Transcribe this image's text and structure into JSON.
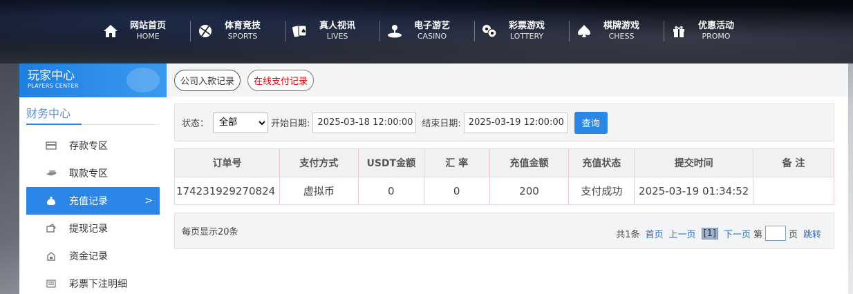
{
  "nav": [
    {
      "cn": "网站首页",
      "en": "HOME",
      "icon": "home-icon"
    },
    {
      "cn": "体育竞技",
      "en": "SPORTS",
      "icon": "ball-icon"
    },
    {
      "cn": "真人视讯",
      "en": "LIVES",
      "icon": "cards-icon"
    },
    {
      "cn": "电子游艺",
      "en": "CASINO",
      "icon": "joystick-icon"
    },
    {
      "cn": "彩票游戏",
      "en": "LOTTERY",
      "icon": "lottery-balls-icon"
    },
    {
      "cn": "棋牌游戏",
      "en": "CHESS",
      "icon": "spade-icon"
    },
    {
      "cn": "优惠活动",
      "en": "PROMO",
      "icon": "gift-icon"
    }
  ],
  "sidebar": {
    "title": "玩家中心",
    "subtitle": "PLAYERS CENTER",
    "section": "财务中心",
    "items": [
      {
        "label": "存款专区",
        "icon": "deposit-icon"
      },
      {
        "label": "取款专区",
        "icon": "withdraw-icon"
      },
      {
        "label": "充值记录",
        "icon": "money-bag-icon",
        "active": true
      },
      {
        "label": "提现记录",
        "icon": "withdraw-record-icon"
      },
      {
        "label": "资金记录",
        "icon": "fund-icon"
      },
      {
        "label": "彩票下注明细",
        "icon": "list-icon"
      }
    ],
    "active_arrow": ">"
  },
  "tabs": [
    "公司入款记录",
    "在线支付记录"
  ],
  "filter": {
    "status_label": "状态：",
    "status_value": "全部",
    "start_label": "开始日期:",
    "start_value": "2025-03-18 12:00:00",
    "end_label": "结束日期:",
    "end_value": "2025-03-19 12:00:00",
    "query_button": "查询"
  },
  "table": {
    "headers": [
      "订单号",
      "支付方式",
      "USDT金额",
      "汇 率",
      "充值金额",
      "充值状态",
      "提交时间",
      "备 注"
    ],
    "rows": [
      [
        "174231929270824",
        "虚拟币",
        "0",
        "0",
        "200",
        "支付成功",
        "2025-03-19 01:34:52",
        ""
      ]
    ]
  },
  "pager": {
    "per_page": "每页显示20条",
    "total": "共1条",
    "first": "首页",
    "prev": "上一页",
    "current": "[1]",
    "next": "下一页",
    "page_prefix": "第",
    "page_suffix": "页",
    "jump": "跳转"
  },
  "colors": {
    "accent": "#2b86e6",
    "active_tab_text": "#dd0000"
  }
}
